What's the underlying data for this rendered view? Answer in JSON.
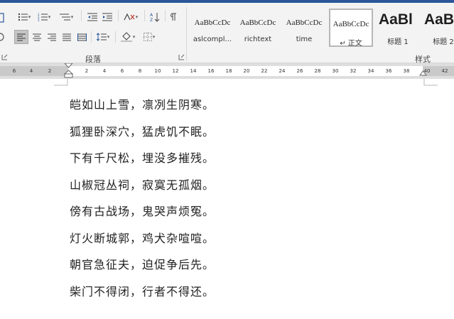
{
  "ribbon": {
    "paragraph_group_label": "段落",
    "styles_group_label": "样式",
    "styles": [
      {
        "sample": "AaBbCcDc",
        "name": "aslcompl...",
        "big": false,
        "selected": false
      },
      {
        "sample": "AaBbCcDc",
        "name": "richtext",
        "big": false,
        "selected": false
      },
      {
        "sample": "AaBbCcDc",
        "name": "time",
        "big": false,
        "selected": false
      },
      {
        "sample": "AaBbCcDc",
        "name": "↵ 正文",
        "big": false,
        "selected": true
      },
      {
        "sample": "AaBl",
        "name": "标题 1",
        "big": true,
        "selected": false
      },
      {
        "sample": "AaBl",
        "name": "标题 2",
        "big": true,
        "selected": false
      }
    ]
  },
  "ruler": {
    "ticks": [
      "6",
      "4",
      "2",
      "2",
      "4",
      "6",
      "8",
      "10",
      "12",
      "14",
      "16",
      "18",
      "20",
      "22",
      "24",
      "26",
      "28",
      "30",
      "32",
      "34",
      "36",
      "38",
      "40",
      "42"
    ]
  },
  "document": {
    "lines": [
      "皑如山上雪，凛冽生阴寒。",
      "狐狸卧深穴，猛虎饥不眠。",
      "下有千尺松，埋没多摧残。",
      "山椒冠丛祠，寂寞无孤烟。",
      "傍有古战场，鬼哭声烦冤。",
      "灯火断城郭，鸡犬杂喧喧。",
      "朝官急征夫，迫促争后先。",
      "柴门不得闭，行者不得还。"
    ]
  }
}
